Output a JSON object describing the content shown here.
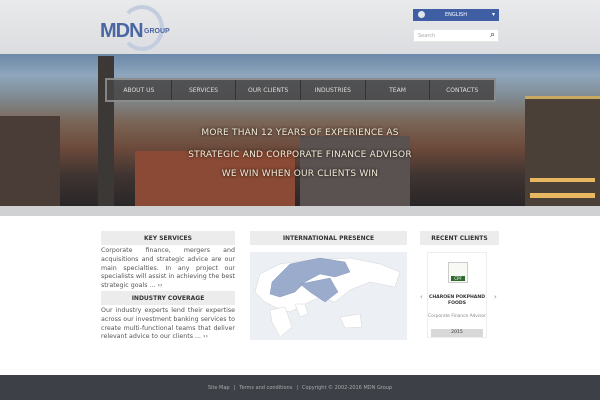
{
  "header": {
    "logo_main": "MDN",
    "logo_sub": "GROUP",
    "language": "ENGLISH",
    "search_placeholder": "Search"
  },
  "nav": [
    "ABOUT US",
    "SERVICES",
    "OUR CLIENTS",
    "INDUSTRIES",
    "TEAM",
    "CONTACTS"
  ],
  "slogan": [
    "MORE THAN 12 YEARS OF EXPERIENCE AS",
    "STRATEGIC AND CORPORATE FINANCE ADVISOR",
    "WE WIN WHEN OUR CLIENTS WIN"
  ],
  "key_services": {
    "title": "KEY SERVICES",
    "text": "Corporate finance, mergers and acquisitions and strategic advice are our main specialties. In any project our specialists will assist in achieving the best strategic goals ... ››"
  },
  "industry": {
    "title": "INDUSTRY COVERAGE",
    "text": "Our industry experts lend their expertise across our investment banking services to create multi-functional teams that deliver relevant advice to our clients ... ››"
  },
  "presence": {
    "title": "INTERNATIONAL PRESENCE"
  },
  "clients": {
    "title": "RECENT CLIENTS",
    "logo": "CPF",
    "name": "CHAROEN POKPHAND FOODS",
    "role": "Corporate Finance Advisor",
    "year": "2015",
    "prev": "‹",
    "next": "›"
  },
  "footer": {
    "sitemap": "Site Map",
    "sep": "|",
    "terms": "Terms and conditions",
    "copyright": "Copyright © 2002-2016 MDN Group"
  },
  "colors": {
    "brand": "#4a66a3",
    "footer": "#3d4047"
  }
}
